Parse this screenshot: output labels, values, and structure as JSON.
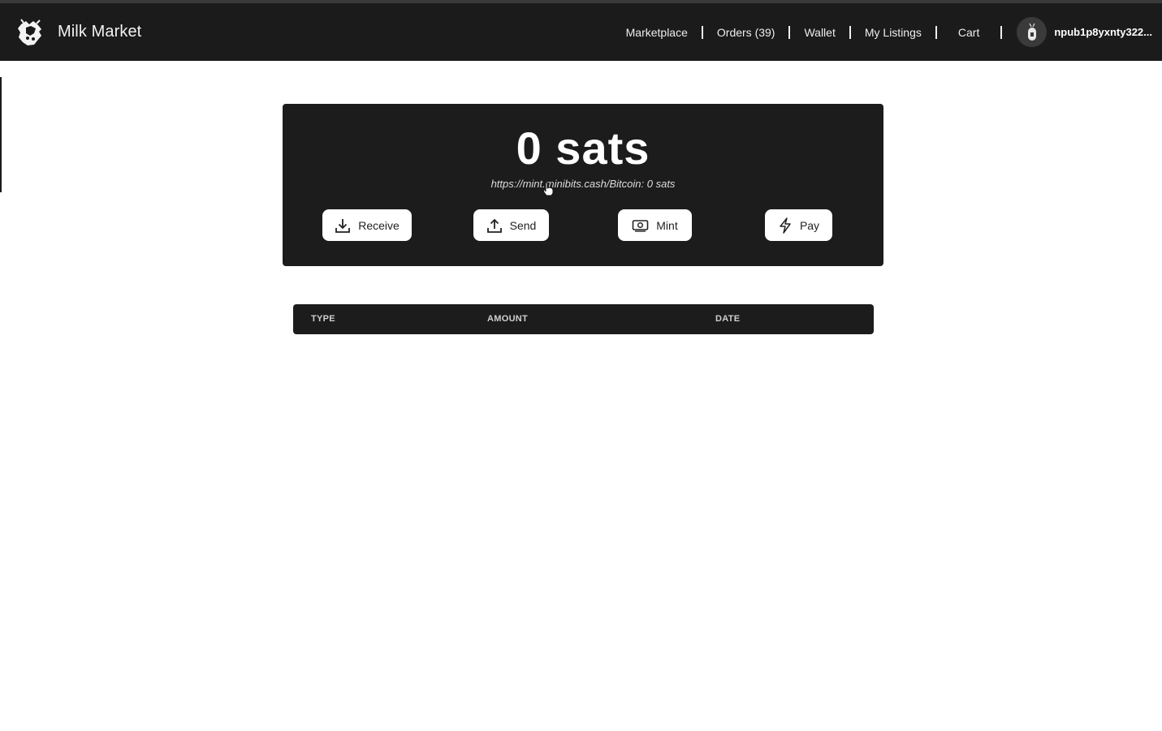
{
  "navbar": {
    "brand_name": "Milk Market",
    "links": {
      "marketplace": "Marketplace",
      "orders": "Orders (39)",
      "wallet": "Wallet",
      "my_listings": "My Listings",
      "cart": "Cart"
    },
    "user_npub": "npub1p8yxnty322..."
  },
  "wallet": {
    "balance": "0 sats",
    "mint_info": "https://mint.minibits.cash/Bitcoin: 0 sats",
    "actions": {
      "receive": "Receive",
      "send": "Send",
      "mint": "Mint",
      "pay": "Pay"
    }
  },
  "transactions": {
    "columns": {
      "type": "TYPE",
      "amount": "AMOUNT",
      "date": "DATE"
    },
    "rows": []
  },
  "colors": {
    "navbar_bg": "#1b1b1b",
    "card_bg": "#1c1c1c",
    "button_bg": "#ffffff"
  },
  "icons": {
    "brand": "cow-logo-icon",
    "receive": "download-icon",
    "send": "upload-icon",
    "mint": "banknote-icon",
    "pay": "lightning-icon"
  }
}
